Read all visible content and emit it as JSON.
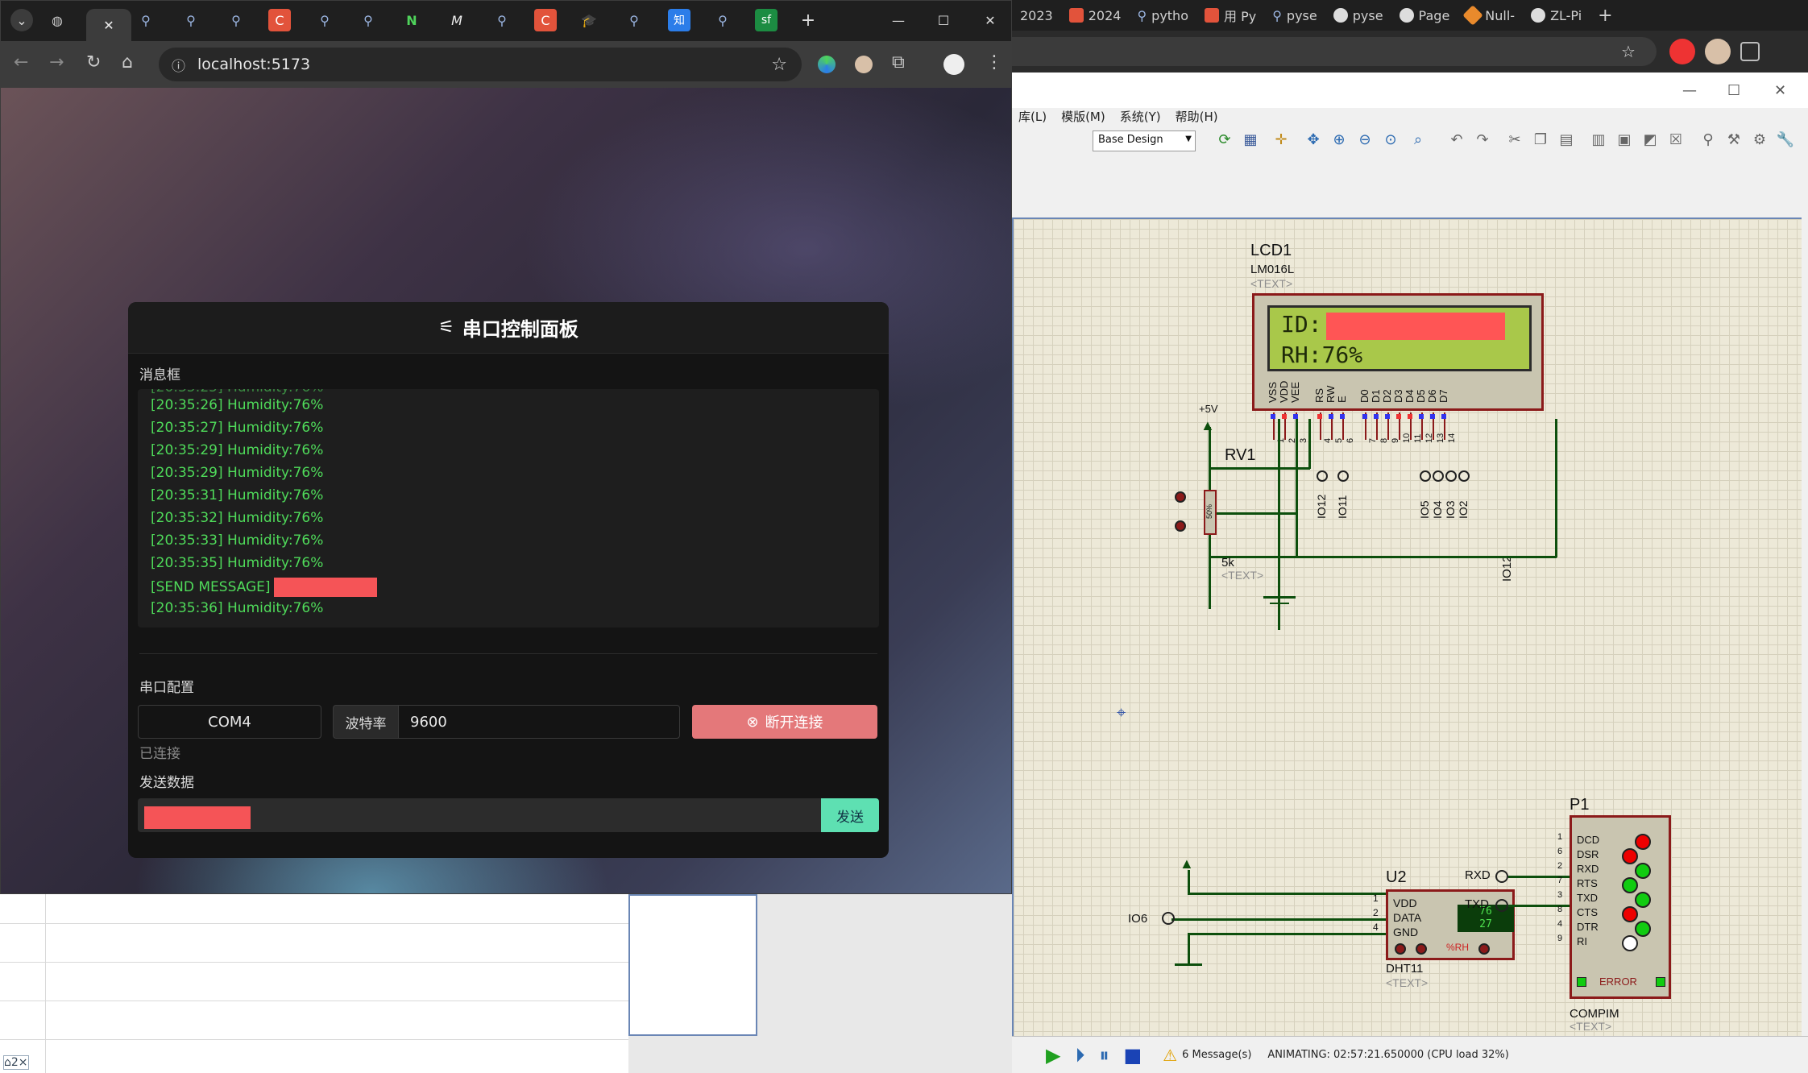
{
  "browser": {
    "url": "localhost:5173",
    "bg_tabs": [
      "2023",
      "2024",
      "pytho",
      "用 Py",
      "pyse",
      "pyse",
      "Page",
      "Null-",
      "ZL-Pi"
    ]
  },
  "panel": {
    "title": "串口控制面板",
    "msgbox_label": "消息框",
    "messages": [
      "[20:35:26] Humidity:76%",
      "[20:35:27] Humidity:76%",
      "[20:35:29] Humidity:76%",
      "[20:35:29] Humidity:76%",
      "[20:35:31] Humidity:76%",
      "[20:35:32] Humidity:76%",
      "[20:35:33] Humidity:76%",
      "[20:35:35] Humidity:76%",
      "[SEND MESSAGE]",
      "[20:35:36] Humidity:76%"
    ],
    "serial_label": "串口配置",
    "port_value": "COM4",
    "baud_label": "波特率",
    "baud_value": "9600",
    "disconnect_label": "断开连接",
    "status_text": "已连接",
    "send_label": "发送数据",
    "send_button": "发送"
  },
  "proteus": {
    "menu": [
      "库(L)",
      "模版(M)",
      "系统(Y)",
      "帮助(H)"
    ],
    "design_select": "Base Design",
    "lcd": {
      "ref": "LCD1",
      "model": "LM016L",
      "text_tag": "<TEXT>",
      "line1": "ID:",
      "line2": "RH:76%",
      "pins": [
        "VSS",
        "VDD",
        "VEE",
        "RS",
        "RW",
        "E",
        "D0",
        "D1",
        "D2",
        "D3",
        "D4",
        "D5",
        "D6",
        "D7"
      ],
      "pin_numbers": [
        "1",
        "2",
        "3",
        "4",
        "5",
        "6",
        "7",
        "8",
        "9",
        "10",
        "11",
        "12",
        "13",
        "14"
      ],
      "io_labels": [
        "IO12",
        "IO11",
        "IO5",
        "IO4",
        "IO3",
        "IO2"
      ]
    },
    "rv1": {
      "ref": "RV1",
      "value": "5k",
      "text_tag": "<TEXT>",
      "supply": "+5V",
      "percent": "50%"
    },
    "dht": {
      "ref": "U2",
      "model": "DHT11",
      "text_tag": "<TEXT>",
      "pins": [
        "VDD",
        "DATA",
        "GND"
      ],
      "pin_numbers": [
        "1",
        "2",
        "4"
      ],
      "io_label": "IO6",
      "display_top": "76",
      "display_bottom": "27",
      "unit": "%RH"
    },
    "compim": {
      "ref": "P1",
      "model": "COMPIM",
      "text_tag": "<TEXT>",
      "signals": [
        "DCD",
        "DSR",
        "RXD",
        "RTS",
        "TXD",
        "CTS",
        "DTR",
        "RI"
      ],
      "pin_numbers": [
        "1",
        "6",
        "2",
        "7",
        "3",
        "8",
        "4",
        "9"
      ],
      "left_labels": [
        "RXD",
        "TXD"
      ],
      "error_label": "ERROR"
    },
    "status": {
      "messages": "6 Message(s)",
      "animating": "ANIMATING: 02:57:21.650000 (CPU load 32%)"
    }
  }
}
